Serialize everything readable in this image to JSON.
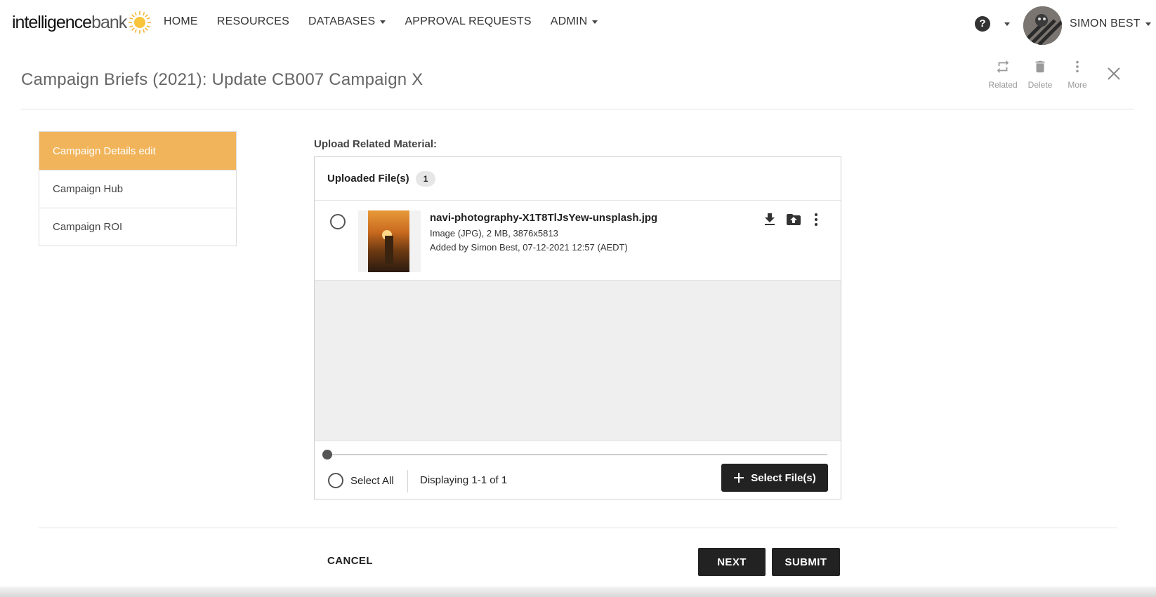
{
  "brand": {
    "logo_main": "intelligence",
    "logo_sub": "bank",
    "accent": "#f1b45a"
  },
  "nav": {
    "items": [
      {
        "label": "HOME",
        "dropdown": false
      },
      {
        "label": "RESOURCES",
        "dropdown": false
      },
      {
        "label": "DATABASES",
        "dropdown": true
      },
      {
        "label": "APPROVAL REQUESTS",
        "dropdown": false
      },
      {
        "label": "ADMIN",
        "dropdown": true
      }
    ],
    "help_icon": "?",
    "user_name": "SIMON BEST"
  },
  "header": {
    "title": "Campaign Briefs (2021): Update CB007 Campaign X",
    "actions": {
      "related": "Related",
      "delete": "Delete",
      "more": "More"
    }
  },
  "sidebar": {
    "items": [
      {
        "label": "Campaign Details edit",
        "active": true
      },
      {
        "label": "Campaign Hub",
        "active": false
      },
      {
        "label": "Campaign ROI",
        "active": false
      }
    ]
  },
  "upload": {
    "label": "Upload Related Material:",
    "panel_title": "Uploaded File(s)",
    "count": "1",
    "files": [
      {
        "name": "navi-photography-X1T8TlJsYew-unsplash.jpg",
        "meta": "Image (JPG), 2 MB, 3876x5813",
        "added": "Added by Simon Best, 07-12-2021 12:57 (AEDT)"
      }
    ],
    "select_all": "Select All",
    "displaying": "Displaying 1-1 of 1",
    "select_files": "Select File(s)"
  },
  "footer": {
    "cancel": "CANCEL",
    "next": "NEXT",
    "submit": "SUBMIT"
  }
}
